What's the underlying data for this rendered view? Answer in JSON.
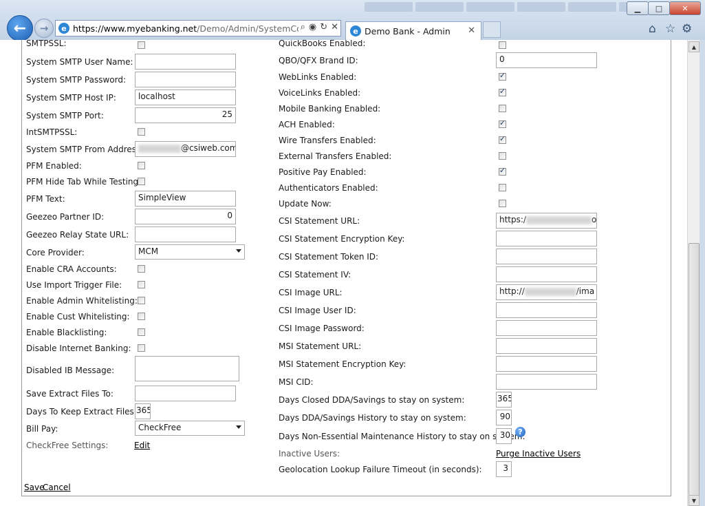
{
  "browser": {
    "url_host": "https://www.myebanking.net",
    "url_path": "/Demo/Admin/SystemConfi",
    "tab_title": "Demo Bank - Admin",
    "tab_close": "✕",
    "back_icon": "←",
    "forward_icon": "→",
    "addr_search": "⌕",
    "addr_lock": "🔒",
    "addr_refresh": "↻",
    "addr_stop": "✕",
    "win_min": "▁",
    "win_max": "□",
    "win_close": "✕",
    "home_icon": "⌂",
    "fav_icon": "☆",
    "tools_icon": "⚙"
  },
  "left": {
    "smtp_ssl": {
      "label": "SMTPSSL:",
      "checked": false
    },
    "smtp_user": {
      "label": "System SMTP User Name:",
      "value": ""
    },
    "smtp_password": {
      "label": "System SMTP Password:",
      "value": ""
    },
    "smtp_host": {
      "label": "System SMTP Host IP:",
      "value": "localhost"
    },
    "smtp_port": {
      "label": "System SMTP Port:",
      "value": "25"
    },
    "int_smtp_ssl": {
      "label": "IntSMTPSSL:",
      "checked": false
    },
    "smtp_from": {
      "label": "System SMTP From Address:",
      "value_suffix": "@csiweb.com"
    },
    "pfm_enabled": {
      "label": "PFM Enabled:",
      "checked": false
    },
    "pfm_hide_tab": {
      "label": "PFM Hide Tab While Testing:",
      "checked": false
    },
    "pfm_text": {
      "label": "PFM Text:",
      "value": "SimpleView"
    },
    "geezeo_partner": {
      "label": "Geezeo Partner ID:",
      "value": "0"
    },
    "geezeo_relay": {
      "label": "Geezeo Relay State URL:",
      "value": ""
    },
    "core_provider": {
      "label": "Core Provider:",
      "value": "MCM"
    },
    "enable_cra": {
      "label": "Enable CRA Accounts:",
      "checked": false
    },
    "use_import_trigger": {
      "label": "Use Import Trigger File:",
      "checked": false
    },
    "enable_admin_whitelist": {
      "label": "Enable Admin Whitelisting:",
      "checked": false
    },
    "enable_cust_whitelist": {
      "label": "Enable Cust Whitelisting:",
      "checked": false
    },
    "enable_blacklist": {
      "label": "Enable Blacklisting:",
      "checked": false
    },
    "disable_ib": {
      "label": "Disable Internet Banking:",
      "checked": false
    },
    "disabled_ib_message": {
      "label": "Disabled IB Message:",
      "value": ""
    },
    "save_extract_files": {
      "label": "Save Extract Files To:",
      "value": ""
    },
    "days_keep_extract": {
      "label": "Days To Keep Extract Files:",
      "value": "365"
    },
    "bill_pay": {
      "label": "Bill Pay:",
      "value": "CheckFree"
    },
    "checkfree_settings": {
      "label": "CheckFree Settings:",
      "link": "Edit"
    }
  },
  "right": {
    "quickbooks": {
      "label": "QuickBooks Enabled:",
      "checked": false
    },
    "qbo_brand": {
      "label": "QBO/QFX Brand ID:",
      "value": "0"
    },
    "weblinks": {
      "label": "WebLinks Enabled:",
      "checked": true
    },
    "voicelinks": {
      "label": "VoiceLinks Enabled:",
      "checked": true
    },
    "mobile_banking": {
      "label": "Mobile Banking Enabled:",
      "checked": false
    },
    "ach": {
      "label": "ACH Enabled:",
      "checked": true
    },
    "wire_transfers": {
      "label": "Wire Transfers Enabled:",
      "checked": true
    },
    "external_transfers": {
      "label": "External Transfers Enabled:",
      "checked": false
    },
    "positive_pay": {
      "label": "Positive Pay Enabled:",
      "checked": true
    },
    "authenticators": {
      "label": "Authenticators Enabled:",
      "checked": false
    },
    "update_now": {
      "label": "Update Now:",
      "checked": false
    },
    "csi_statement_url": {
      "label": "CSI Statement URL:",
      "value_prefix": "https:/",
      "value_suffix": "o"
    },
    "csi_statement_key": {
      "label": "CSI Statement Encryption Key:",
      "value": ""
    },
    "csi_statement_token": {
      "label": "CSI Statement Token ID:",
      "value": ""
    },
    "csi_statement_iv": {
      "label": "CSI Statement IV:",
      "value": ""
    },
    "csi_image_url": {
      "label": "CSI Image URL:",
      "value_prefix": "http://",
      "value_suffix": "/ima"
    },
    "csi_image_user": {
      "label": "CSI Image User ID:",
      "value": ""
    },
    "csi_image_password": {
      "label": "CSI Image Password:",
      "value": ""
    },
    "msi_statement_url": {
      "label": "MSI Statement URL:",
      "value": ""
    },
    "msi_statement_key": {
      "label": "MSI Statement Encryption Key:",
      "value": ""
    },
    "msi_cid": {
      "label": "MSI CID:",
      "value": ""
    },
    "days_closed_dda": {
      "label": "Days Closed DDA/Savings to stay on system:",
      "value": "365"
    },
    "days_dda_history": {
      "label": "Days DDA/Savings History to stay on system:",
      "value": "90"
    },
    "days_non_essential": {
      "label": "Days Non-Essential Maintenance History to stay on system:",
      "value": "30",
      "help": "?"
    },
    "inactive_users": {
      "label": "Inactive Users:",
      "link": "Purge Inactive Users"
    },
    "geolocation_timeout": {
      "label": "Geolocation Lookup Failure Timeout (in seconds):",
      "value": "3"
    }
  },
  "actions": {
    "save": "Save",
    "cancel": "Cancel"
  },
  "scrollbar": {
    "up": "▲",
    "down": "▼"
  }
}
